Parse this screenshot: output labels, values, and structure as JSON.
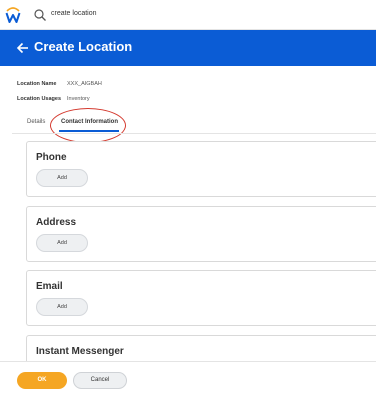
{
  "top_bar": {
    "logo_icon": "workday-w-logo",
    "search_icon": "search-icon",
    "search_value": "create location"
  },
  "header": {
    "back_icon": "back-arrow-icon",
    "title": "Create Location",
    "background_color": "#0b5cd5"
  },
  "fields": [
    {
      "label": "Location Name",
      "value": "XXX_AIGBAH"
    },
    {
      "label": "Location Usages",
      "value": "Inventory"
    }
  ],
  "tabs": [
    {
      "label": "Details",
      "active": false
    },
    {
      "label": "Contact Information",
      "active": true
    }
  ],
  "sections": [
    {
      "title": "Phone",
      "button_label": "Add"
    },
    {
      "title": "Address",
      "button_label": "Add"
    },
    {
      "title": "Email",
      "button_label": "Add"
    },
    {
      "title": "Instant Messenger",
      "button_label": ""
    }
  ],
  "footer": {
    "ok_label": "OK",
    "cancel_label": "Cancel",
    "ok_color": "#f5a623"
  }
}
